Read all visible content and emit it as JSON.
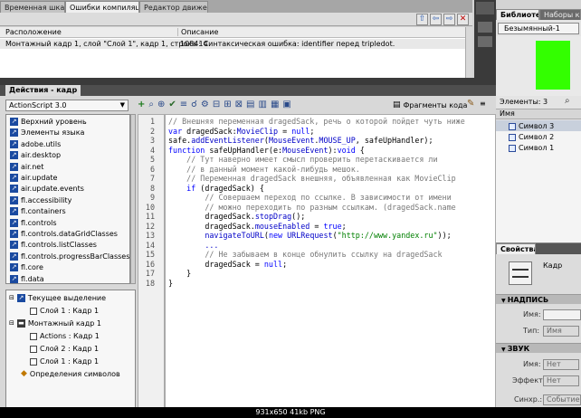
{
  "compiler_panel": {
    "tabs": [
      "Временная шкала",
      "Ошибки компиляции",
      "Редактор движения"
    ],
    "active_tab": 1,
    "col_location": "Расположение",
    "col_description": "Описание",
    "error_location": "Монтажный кадр 1, слой \"Слой 1\", кадр 1, строка 14",
    "error_description": "1084: Синтаксическая ошибка: identifier перед tripledot."
  },
  "library": {
    "tabs": [
      "Библиотека",
      "Наборы ка"
    ],
    "document": "Безымянный-1",
    "preview_color": "#33ff00",
    "count_label": "Элементы: 3",
    "name_header": "Имя",
    "items": [
      "Символ 3",
      "Символ 2",
      "Символ 1"
    ]
  },
  "actions_panel": {
    "title": "Действия - кадр",
    "language": "ActionScript 3.0",
    "snippets_label": "Фрагменты кода",
    "toolbox": [
      "Верхний уровень",
      "Элементы языка",
      "adobe.utils",
      "air.desktop",
      "air.net",
      "air.update",
      "air.update.events",
      "fl.accessibility",
      "fl.containers",
      "fl.controls",
      "fl.controls.dataGridClasses",
      "fl.controls.listClasses",
      "fl.controls.progressBarClasses",
      "fl.core",
      "fl.data"
    ],
    "tree": {
      "current_selection": "Текущее выделение",
      "sel_layer": "Слой 1 : Кадр 1",
      "scene": "Монтажный кадр 1",
      "actions": "Actions : Кадр 1",
      "layer2": "Слой 2 : Кадр 1",
      "layer1": "Слой 1 : Кадр 1",
      "symbol_defs": "Определения символов"
    },
    "line_numbers": [
      "1",
      "2",
      "3",
      "4",
      "5",
      "6",
      "7",
      "8",
      "9",
      "10",
      "11",
      "12",
      "13",
      "14",
      "15",
      "16",
      "17",
      "18"
    ]
  },
  "properties": {
    "tab": "Свойства",
    "type_label": "Кадр",
    "label_section": "НАДПИСЬ",
    "name_label": "Имя:",
    "type_field_label": "Тип:",
    "type_value": "Имя",
    "sound_section": "ЗВУК",
    "sound_name_label": "Имя:",
    "sound_name_value": "Нет",
    "effect_label": "Эффект:",
    "effect_value": "Нет",
    "sync_label": "Синхр.:",
    "sync_value": "Событие"
  },
  "footer": "931x650  41kb  PNG"
}
